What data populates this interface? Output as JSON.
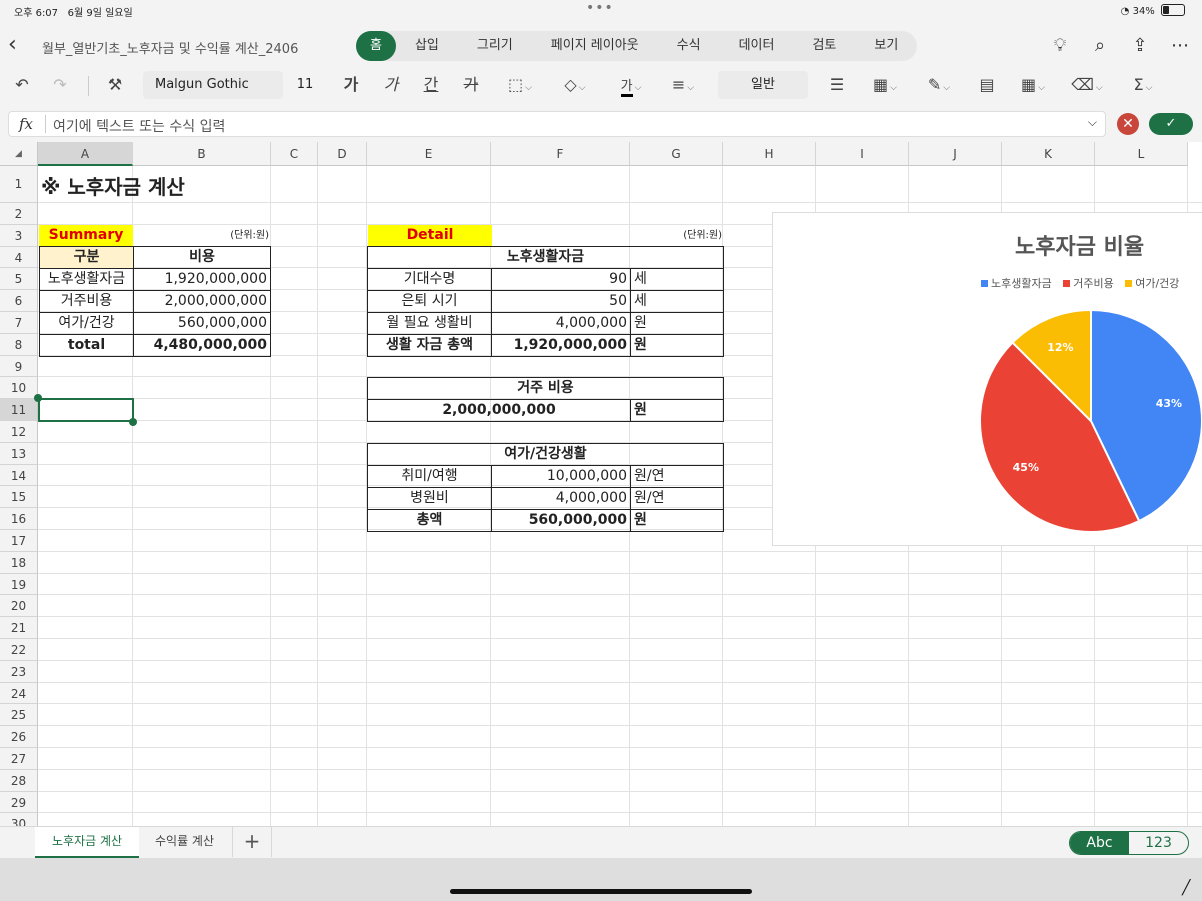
{
  "status": {
    "time": "오후 6:07",
    "date": "6월 9일 일요일",
    "dots": "•••",
    "battery": "34%"
  },
  "app": {
    "doc_title": "월부_열반기초_노후자금 및 수익률 계산_2406",
    "tabs": [
      "홈",
      "삽입",
      "그리기",
      "페이지 레이아웃",
      "수식",
      "데이터",
      "검토",
      "보기"
    ],
    "active_tab": "홈"
  },
  "ribbon": {
    "font": "Malgun Gothic",
    "size": "11",
    "bold": "가",
    "italic": "가",
    "underline": "간",
    "strike": "가",
    "number_format": "일반",
    "font_color": "#000000",
    "fill_color": "#ffff00"
  },
  "formula": {
    "fx": "fx",
    "placeholder": "여기에 텍스트 또는 수식 입력",
    "cancel": "✕",
    "confirm": "✓"
  },
  "grid": {
    "columns": [
      "A",
      "B",
      "C",
      "D",
      "E",
      "F",
      "G",
      "H",
      "I",
      "J",
      "K",
      "L"
    ],
    "rows": [
      "1",
      "2",
      "3",
      "4",
      "5",
      "6",
      "7",
      "8",
      "9",
      "10",
      "11",
      "12",
      "13",
      "14",
      "15",
      "16",
      "17",
      "18",
      "19",
      "20",
      "21",
      "22",
      "23",
      "24",
      "25",
      "26",
      "27",
      "28",
      "29",
      "30"
    ],
    "selected": "A11"
  },
  "sheet": {
    "title": "※ 노후자금 계산",
    "summary": {
      "label": "Summary",
      "unit": "(단위:원)",
      "headers": [
        "구분",
        "비용"
      ],
      "rows": [
        {
          "name": "노후생활자금",
          "value": "1,920,000,000"
        },
        {
          "name": "거주비용",
          "value": "2,000,000,000"
        },
        {
          "name": "여가/건강",
          "value": "560,000,000"
        },
        {
          "name": "total",
          "value": "4,480,000,000"
        }
      ]
    },
    "detail": {
      "label": "Detail",
      "unit": "(단위:원)",
      "living": {
        "title": "노후생활자금",
        "rows": [
          {
            "name": "기대수명",
            "value": "90",
            "unit": "세"
          },
          {
            "name": "은퇴 시기",
            "value": "50",
            "unit": "세"
          },
          {
            "name": "월 필요 생활비",
            "value": "4,000,000",
            "unit": "원"
          },
          {
            "name": "생활 자금 총액",
            "value": "1,920,000,000",
            "unit": "원"
          }
        ]
      },
      "housing": {
        "title": "거주 비용",
        "value": "2,000,000,000",
        "unit": "원"
      },
      "leisure": {
        "title": "여가/건강생활",
        "rows": [
          {
            "name": "취미/여행",
            "value": "10,000,000",
            "unit": "원/연"
          },
          {
            "name": "병원비",
            "value": "4,000,000",
            "unit": "원/연"
          },
          {
            "name": "총액",
            "value": "560,000,000",
            "unit": "원"
          }
        ]
      }
    }
  },
  "chart_data": {
    "type": "pie",
    "title": "노후자금 비율",
    "categories": [
      "노후생활자금",
      "거주비용",
      "여가/건강"
    ],
    "legend": [
      "노후생활자금",
      "거주비용",
      "여가/건강"
    ],
    "values": [
      1920000000,
      2000000000,
      560000000
    ],
    "labels": [
      "43%",
      "45%",
      "12%"
    ],
    "colors": [
      "#4285f4",
      "#ea4335",
      "#fbbc04"
    ],
    "legend_position": "top"
  },
  "sheet_tabs": [
    "노후자금 계산",
    "수익률 계산"
  ],
  "add_sheet": "+",
  "keyboard": {
    "abc": "Abc",
    "num": "123"
  }
}
